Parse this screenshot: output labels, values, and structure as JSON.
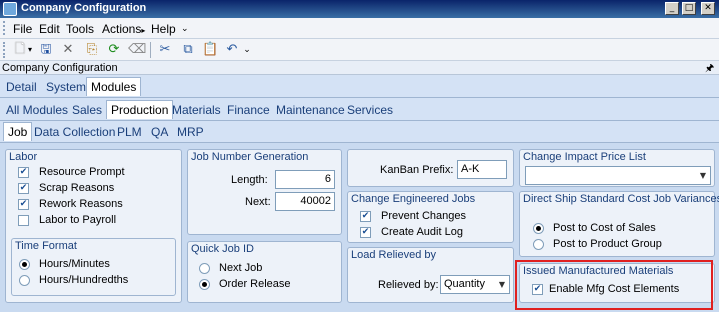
{
  "window": {
    "title": "Company Configuration",
    "min": "_",
    "max": "□",
    "close": "✕"
  },
  "menu": [
    "File",
    "Edit",
    "Tools",
    "Actions",
    "Help"
  ],
  "toolbar": {
    "icons": [
      "new-icon",
      "dropdown-arrow-icon",
      "save-icon",
      "delete-icon",
      "copy-doc-icon",
      "refresh-icon",
      "clear-icon",
      "cut-icon",
      "copy-icon",
      "paste-icon",
      "undo-icon",
      "overflow-icon"
    ]
  },
  "panel": {
    "title": "Company Configuration",
    "pin": "🖈"
  },
  "tabs": {
    "top": [
      "Detail",
      "System",
      "Modules"
    ],
    "modules": [
      "All Modules",
      "Sales",
      "Production",
      "Materials",
      "Finance",
      "Maintenance",
      "Services"
    ],
    "production": [
      "Job",
      "Data Collection",
      "PLM",
      "QA",
      "MRP"
    ]
  },
  "labor": {
    "title": "Labor",
    "items": [
      {
        "label": "Resource Prompt",
        "checked": true
      },
      {
        "label": "Scrap Reasons",
        "checked": true
      },
      {
        "label": "Rework Reasons",
        "checked": true
      },
      {
        "label": "Labor to Payroll",
        "checked": false
      }
    ]
  },
  "time_format": {
    "title": "Time Format",
    "options": [
      "Hours/Minutes",
      "Hours/Hundredths"
    ],
    "selected": 0
  },
  "job_number": {
    "title": "Job Number Generation",
    "length_label": "Length:",
    "length_value": "6",
    "next_label": "Next:",
    "next_value": "40002"
  },
  "quick_job": {
    "title": "Quick Job ID",
    "options": [
      "Next Job",
      "Order Release"
    ],
    "selected": 1
  },
  "kanban": {
    "label": "KanBan Prefix:",
    "value": "A-K"
  },
  "engineered": {
    "title": "Change Engineered Jobs",
    "items": [
      {
        "label": "Prevent Changes",
        "checked": true
      },
      {
        "label": "Create Audit Log",
        "checked": true
      }
    ]
  },
  "load_relieved": {
    "title": "Load Relieved by",
    "label": "Relieved by:",
    "value": "Quantity"
  },
  "impact_price": {
    "title": "Change Impact Price List",
    "value": ""
  },
  "direct_ship": {
    "title": "Direct Ship Standard Cost Job Variances",
    "options": [
      "Post to Cost of Sales",
      "Post to Product Group"
    ],
    "selected": 0
  },
  "issued_mfg": {
    "title": "Issued Manufactured Materials",
    "item": {
      "label": "Enable Mfg Cost Elements",
      "checked": true
    }
  },
  "colors": {
    "titlebar": "#0a246a",
    "group_title": "#1a3f7a",
    "highlight": "#e02020"
  }
}
